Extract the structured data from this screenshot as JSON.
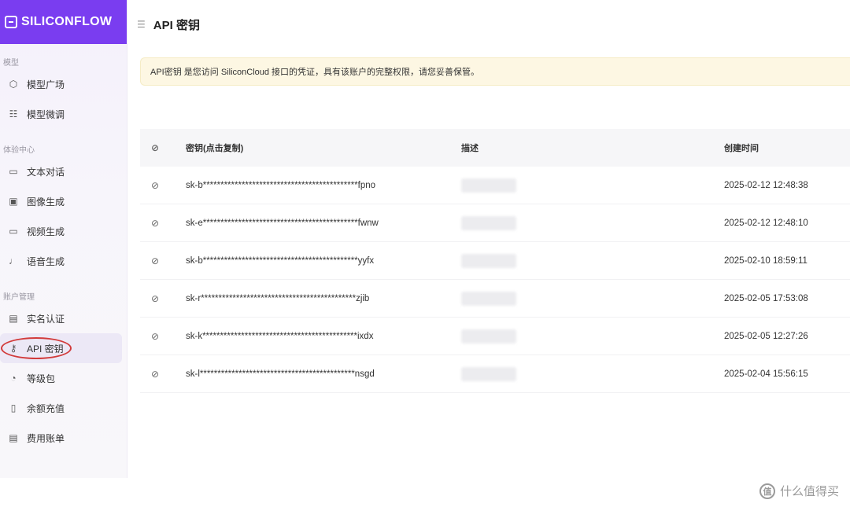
{
  "brand": {
    "logo_text": "SILICONFLOW"
  },
  "sidebar": {
    "sections": [
      {
        "title": "模型",
        "items": [
          {
            "label": "模型广场",
            "icon": "cube-icon"
          },
          {
            "label": "模型微调",
            "icon": "sliders-icon"
          }
        ]
      },
      {
        "title": "体验中心",
        "items": [
          {
            "label": "文本对话",
            "icon": "chat-icon"
          },
          {
            "label": "图像生成",
            "icon": "image-icon"
          },
          {
            "label": "视频生成",
            "icon": "video-icon"
          },
          {
            "label": "语音生成",
            "icon": "mic-icon"
          }
        ]
      },
      {
        "title": "账户管理",
        "items": [
          {
            "label": "实名认证",
            "icon": "id-card-icon"
          },
          {
            "label": "API 密钥",
            "icon": "key-icon",
            "active": true
          },
          {
            "label": "等级包",
            "icon": "gauge-icon"
          },
          {
            "label": "余额充值",
            "icon": "wallet-icon"
          },
          {
            "label": "费用账单",
            "icon": "bill-icon"
          }
        ]
      }
    ]
  },
  "header": {
    "title": "API 密钥"
  },
  "notice": {
    "text": "API密钥 是您访问 SiliconCloud 接口的凭证，具有该账户的完整权限，请您妥善保管。"
  },
  "table": {
    "headers": [
      "密钥(点击复制)",
      "描述",
      "创建时间"
    ],
    "rows": [
      {
        "key": "sk-b********************************************fpno",
        "time": "2025-02-12 12:48:38"
      },
      {
        "key": "sk-e********************************************fwnw",
        "time": "2025-02-12 12:48:10"
      },
      {
        "key": "sk-b********************************************yyfx",
        "time": "2025-02-10 18:59:11"
      },
      {
        "key": "sk-r********************************************zjib",
        "time": "2025-02-05 17:53:08"
      },
      {
        "key": "sk-k********************************************ixdx",
        "time": "2025-02-05 12:27:26"
      },
      {
        "key": "sk-l********************************************nsgd",
        "time": "2025-02-04 15:56:15"
      }
    ]
  },
  "watermark": {
    "badge": "值",
    "text": "什么值得买"
  }
}
